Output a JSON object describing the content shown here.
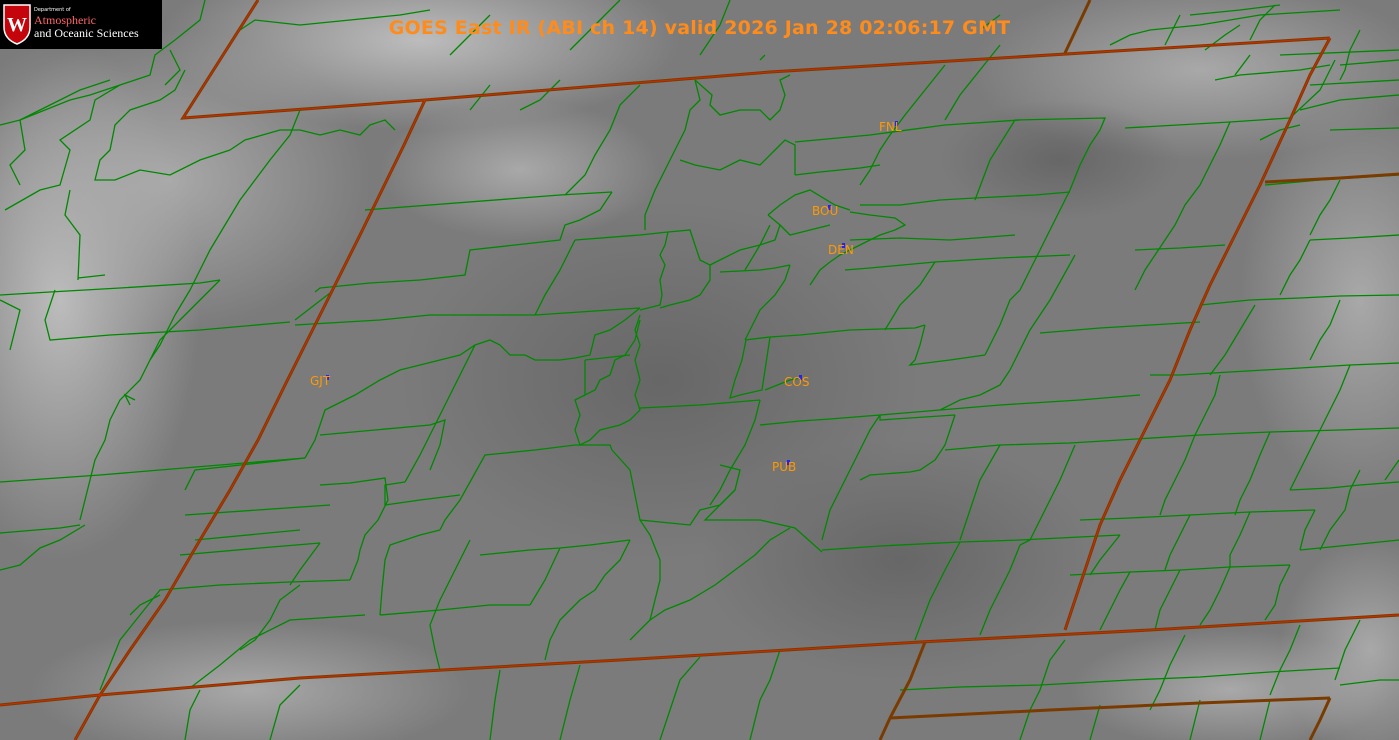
{
  "title": "GOES East IR (ABI ch 14) valid 2026 Jan 28 02:06:17 GMT",
  "logo": {
    "small_text": "Department of",
    "line1": "Atmospheric",
    "line2": "and Oceanic Sciences",
    "seal_letter": "W"
  },
  "stations": [
    {
      "id": "FNL",
      "label": "FNL"
    },
    {
      "id": "BOU",
      "label": "BOU"
    },
    {
      "id": "DEN",
      "label": "DEN"
    },
    {
      "id": "GJT",
      "label": "GJT"
    },
    {
      "id": "COS",
      "label": "COS"
    },
    {
      "id": "PUB",
      "label": "PUB"
    }
  ],
  "colors": {
    "title": "#ff8c1a",
    "label": "#ff9900",
    "county_line": "#008800",
    "state_line": "#7a3b00",
    "state_line_core": "#ff2200",
    "station_marker": "#2222ff",
    "logo_red": "#c5050c",
    "logo_bg": "#000000",
    "logo_text": "#ffffff"
  }
}
